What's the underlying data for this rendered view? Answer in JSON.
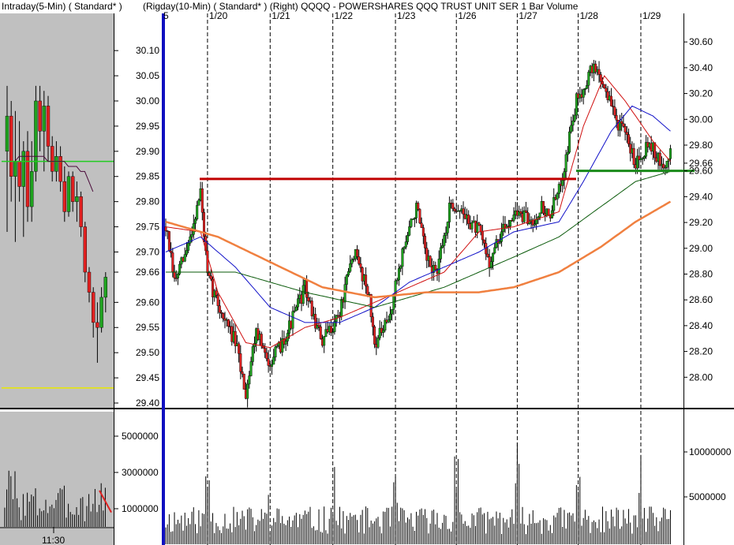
{
  "title_bar": {
    "left_pane": "Intraday(5-Min) ( Standard* )",
    "right_pane": "(Rigday(10-Min) ( Standard* )   (Right)  QQQQ - POWERSHARES QQQ TRUST UNIT SER 1  Bar  Volume"
  },
  "colors": {
    "up": "#1fa31f",
    "down": "#e02020",
    "ma_red": "#d01010",
    "ma_blue": "#1010c8",
    "ma_green": "#0a5a0a",
    "ma_orange": "#f08040",
    "resistance": "#c00000",
    "support": "#1a8a1a",
    "left_bg": "#c0c0c0",
    "cursor": "#1010c0"
  },
  "chart_data": [
    {
      "type": "candlestick",
      "pane": "intraday-5min",
      "ylim": [
        29.4,
        30.13
      ],
      "horizontal_lines": [
        {
          "y": 29.88,
          "color": "green"
        },
        {
          "y": 29.43,
          "color": "yellow"
        }
      ],
      "bars": [
        {
          "o": 29.9,
          "h": 30.03,
          "l": 29.74,
          "c": 29.97
        },
        {
          "o": 29.97,
          "h": 30.0,
          "l": 29.8,
          "c": 29.85
        },
        {
          "o": 29.85,
          "h": 29.98,
          "l": 29.72,
          "c": 29.88
        },
        {
          "o": 29.88,
          "h": 29.96,
          "l": 29.8,
          "c": 29.83
        },
        {
          "o": 29.83,
          "h": 29.92,
          "l": 29.73,
          "c": 29.9
        },
        {
          "o": 29.9,
          "h": 29.94,
          "l": 29.76,
          "c": 29.79
        },
        {
          "o": 29.79,
          "h": 29.92,
          "l": 29.76,
          "c": 29.86
        },
        {
          "o": 29.86,
          "h": 30.03,
          "l": 29.84,
          "c": 30.0
        },
        {
          "o": 30.0,
          "h": 30.03,
          "l": 29.9,
          "c": 29.94
        },
        {
          "o": 29.94,
          "h": 30.02,
          "l": 29.86,
          "c": 29.99
        },
        {
          "o": 29.99,
          "h": 30.01,
          "l": 29.88,
          "c": 29.91
        },
        {
          "o": 29.91,
          "h": 29.93,
          "l": 29.84,
          "c": 29.86
        },
        {
          "o": 29.86,
          "h": 29.92,
          "l": 29.84,
          "c": 29.89
        },
        {
          "o": 29.89,
          "h": 29.91,
          "l": 29.82,
          "c": 29.84
        },
        {
          "o": 29.84,
          "h": 29.87,
          "l": 29.76,
          "c": 29.78
        },
        {
          "o": 29.78,
          "h": 29.86,
          "l": 29.77,
          "c": 29.85
        },
        {
          "o": 29.85,
          "h": 29.86,
          "l": 29.78,
          "c": 29.8
        },
        {
          "o": 29.8,
          "h": 29.84,
          "l": 29.76,
          "c": 29.81
        },
        {
          "o": 29.81,
          "h": 29.82,
          "l": 29.73,
          "c": 29.75
        },
        {
          "o": 29.75,
          "h": 29.76,
          "l": 29.64,
          "c": 29.66
        },
        {
          "o": 29.66,
          "h": 29.67,
          "l": 29.6,
          "c": 29.62
        },
        {
          "o": 29.62,
          "h": 29.63,
          "l": 29.53,
          "c": 29.56
        },
        {
          "o": 29.56,
          "h": 29.6,
          "l": 29.48,
          "c": 29.55
        },
        {
          "o": 29.55,
          "h": 29.63,
          "l": 29.54,
          "c": 29.61
        },
        {
          "o": 29.61,
          "h": 29.66,
          "l": 29.58,
          "c": 29.65
        }
      ],
      "ma_line": [
        29.88,
        29.89,
        29.89,
        29.89,
        29.89,
        29.89,
        29.89,
        29.89,
        29.88,
        29.88,
        29.88,
        29.88,
        29.88,
        29.87,
        29.87,
        29.87,
        29.86,
        29.86,
        29.84,
        29.82
      ]
    },
    {
      "type": "bar",
      "pane": "intraday-volume",
      "ylim": [
        0,
        6000000
      ],
      "y_ticks": [
        "1000000",
        "3000000",
        "5000000"
      ],
      "x_ticks": [
        "11:30"
      ],
      "trendline": [
        {
          "x": 23,
          "y": 2000000
        },
        {
          "x": 25,
          "y": 800000
        }
      ]
    },
    {
      "type": "candlestick",
      "pane": "ten-minute",
      "ylim": [
        29.4,
        30.13
      ],
      "y_ticks": [
        "29.40",
        "29.45",
        "29.50",
        "29.55",
        "29.60",
        "29.66",
        "29.70",
        "29.75",
        "29.80",
        "29.85",
        "29.90",
        "29.95",
        "30.00",
        "30.05",
        "30.10"
      ],
      "right_ylim": [
        27.8,
        30.65
      ],
      "right_y_ticks": [
        "28.00",
        "28.20",
        "28.40",
        "28.60",
        "28.80",
        "29.00",
        "29.20",
        "29.40",
        "29.60",
        "29.66",
        "29.80",
        "30.00",
        "30.20",
        "30.40",
        "30.60"
      ],
      "x_ticks": [
        "5",
        "1/20",
        "1/21",
        "1/22",
        "1/23",
        "1/26",
        "1/27",
        "1/28",
        "1/29"
      ],
      "resistance": 29.845,
      "support_right_axis": 29.6,
      "waypoints": [
        [
          0,
          29.75
        ],
        [
          5,
          29.64
        ],
        [
          12,
          29.7
        ],
        [
          20,
          29.82
        ],
        [
          24,
          29.65
        ],
        [
          32,
          29.58
        ],
        [
          40,
          29.52
        ],
        [
          46,
          29.42
        ],
        [
          52,
          29.55
        ],
        [
          58,
          29.48
        ],
        [
          64,
          29.5
        ],
        [
          72,
          29.56
        ],
        [
          80,
          29.63
        ],
        [
          84,
          29.58
        ],
        [
          90,
          29.52
        ],
        [
          100,
          29.58
        ],
        [
          108,
          29.7
        ],
        [
          116,
          29.63
        ],
        [
          120,
          29.52
        ],
        [
          128,
          29.56
        ],
        [
          136,
          29.7
        ],
        [
          144,
          29.79
        ],
        [
          150,
          29.68
        ],
        [
          156,
          29.66
        ],
        [
          164,
          29.8
        ],
        [
          172,
          29.77
        ],
        [
          180,
          29.74
        ],
        [
          186,
          29.68
        ],
        [
          192,
          29.73
        ],
        [
          200,
          29.78
        ],
        [
          210,
          29.76
        ],
        [
          216,
          29.79
        ],
        [
          220,
          29.77
        ],
        [
          226,
          29.82
        ],
        [
          236,
          30.0
        ],
        [
          246,
          30.07
        ],
        [
          252,
          30.03
        ],
        [
          258,
          29.97
        ],
        [
          264,
          29.93
        ],
        [
          270,
          29.88
        ],
        [
          278,
          29.92
        ],
        [
          286,
          29.86
        ],
        [
          290,
          29.9
        ]
      ],
      "moving_averages": [
        {
          "name": "red",
          "waypoints": [
            [
              0,
              29.75
            ],
            [
              20,
              29.74
            ],
            [
              30,
              29.62
            ],
            [
              46,
              29.52
            ],
            [
              60,
              29.51
            ],
            [
              80,
              29.55
            ],
            [
              100,
              29.57
            ],
            [
              120,
              29.6
            ],
            [
              140,
              29.63
            ],
            [
              160,
              29.66
            ],
            [
              180,
              29.74
            ],
            [
              200,
              29.75
            ],
            [
              226,
              29.78
            ],
            [
              240,
              29.95
            ],
            [
              252,
              30.05
            ],
            [
              264,
              30.0
            ],
            [
              280,
              29.92
            ],
            [
              290,
              29.88
            ]
          ]
        },
        {
          "name": "blue",
          "waypoints": [
            [
              0,
              29.7
            ],
            [
              20,
              29.73
            ],
            [
              40,
              29.67
            ],
            [
              60,
              29.59
            ],
            [
              80,
              29.56
            ],
            [
              100,
              29.56
            ],
            [
              120,
              29.59
            ],
            [
              140,
              29.64
            ],
            [
              160,
              29.67
            ],
            [
              180,
              29.7
            ],
            [
              200,
              29.74
            ],
            [
              226,
              29.76
            ],
            [
              240,
              29.84
            ],
            [
              256,
              29.94
            ],
            [
              268,
              29.99
            ],
            [
              280,
              29.97
            ],
            [
              290,
              29.94
            ]
          ]
        },
        {
          "name": "green",
          "waypoints": [
            [
              0,
              29.66
            ],
            [
              40,
              29.66
            ],
            [
              80,
              29.62
            ],
            [
              120,
              29.59
            ],
            [
              160,
              29.63
            ],
            [
              200,
              29.69
            ],
            [
              226,
              29.73
            ],
            [
              250,
              29.79
            ],
            [
              270,
              29.84
            ],
            [
              290,
              29.86
            ]
          ]
        },
        {
          "name": "orange",
          "waypoints": [
            [
              0,
              29.76
            ],
            [
              30,
              29.73
            ],
            [
              60,
              29.68
            ],
            [
              90,
              29.63
            ],
            [
              120,
              29.61
            ],
            [
              150,
              29.62
            ],
            [
              180,
              29.62
            ],
            [
              200,
              29.63
            ],
            [
              226,
              29.66
            ],
            [
              250,
              29.71
            ],
            [
              270,
              29.76
            ],
            [
              290,
              29.8
            ]
          ]
        }
      ]
    },
    {
      "type": "bar",
      "pane": "ten-minute-volume",
      "right_y_ticks": [
        "5000000",
        "10000000"
      ]
    }
  ]
}
